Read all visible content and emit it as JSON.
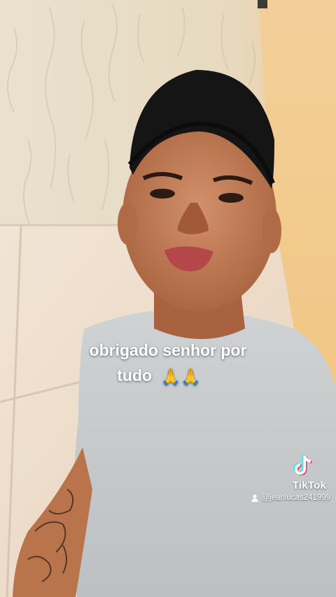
{
  "caption": {
    "line1": "obrigado senhor por",
    "line2": "tudo",
    "emoji": "🙏🙏"
  },
  "watermark": {
    "brand": "TikTok",
    "username": "@jeanlucas241999",
    "logo_icon": "tiktok-note-icon",
    "user_icon": "user-icon"
  },
  "colors": {
    "wall_top": "#e7dcc7",
    "tile": "#efe0cf",
    "orange_wall": "#f4c987",
    "shirt": "#c9ccce",
    "skin": "#c07a52",
    "cap": "#151515",
    "tiktok_cyan": "#25f4ee",
    "tiktok_red": "#fe2c55"
  }
}
